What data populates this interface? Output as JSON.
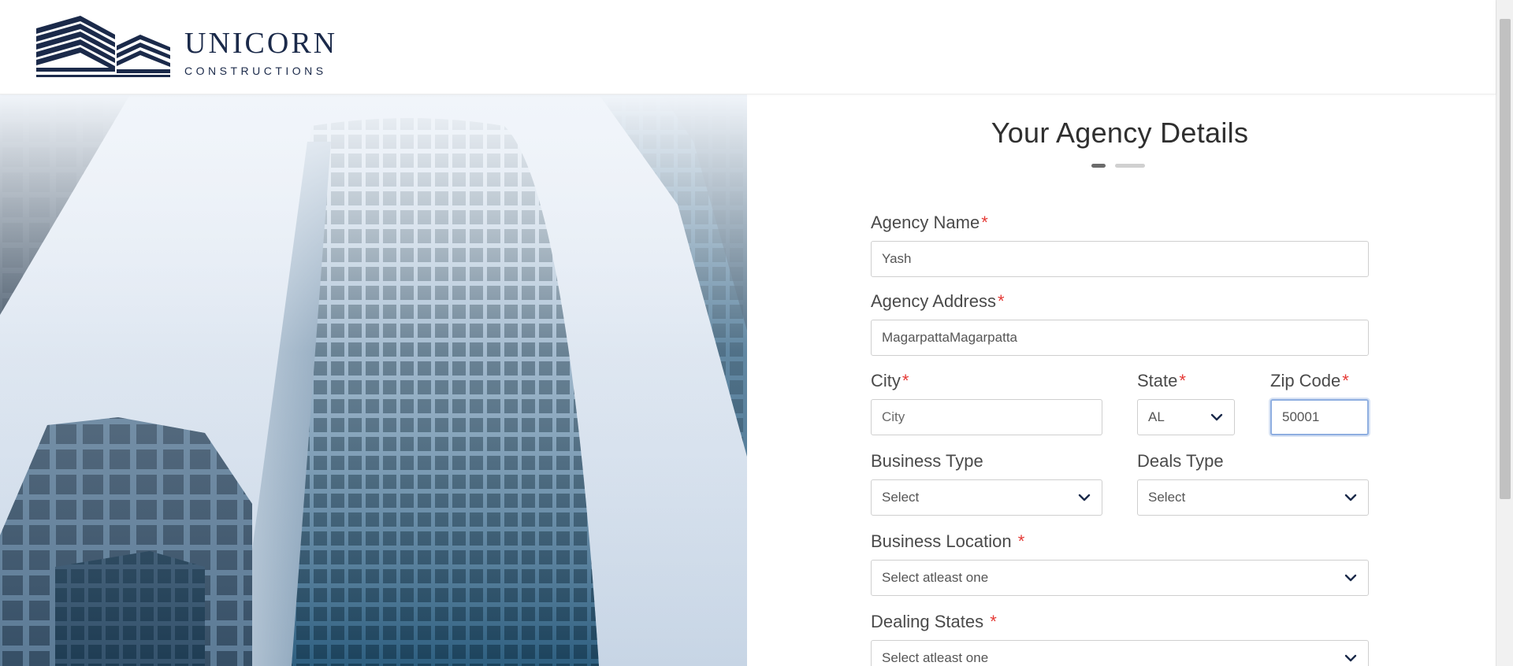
{
  "brand": {
    "name": "UNICORN",
    "tagline": "CONSTRUCTIONS"
  },
  "form": {
    "title": "Your Agency Details",
    "steps": [
      {
        "state": "active"
      },
      {
        "state": "inactive"
      }
    ],
    "required_mark": "*",
    "fields": {
      "agency_name": {
        "label": "Agency Name",
        "value": "Yash",
        "required": true
      },
      "agency_address": {
        "label": "Agency Address",
        "value": "MagarpattaMagarpatta",
        "required": true
      },
      "city": {
        "label": "City",
        "value": "",
        "placeholder": "City",
        "required": true
      },
      "state": {
        "label": "State",
        "value": "AL",
        "required": true
      },
      "zip": {
        "label": "Zip Code",
        "value": "50001",
        "required": true
      },
      "business_type": {
        "label": "Business Type",
        "value": "Select",
        "required": false
      },
      "deals_type": {
        "label": "Deals Type",
        "value": "Select",
        "required": false
      },
      "business_location": {
        "label": "Business Location",
        "value": "Select atleast one",
        "required": true
      },
      "dealing_states": {
        "label": "Dealing States",
        "value": "Select atleast one",
        "required": true
      }
    }
  },
  "colors": {
    "brand_navy": "#1b2a4a",
    "required_red": "#e53935",
    "focus_blue": "#8eaee0"
  },
  "icons": {
    "select_arrow": "chevron-down-icon",
    "logo": "building-logo-icon"
  }
}
